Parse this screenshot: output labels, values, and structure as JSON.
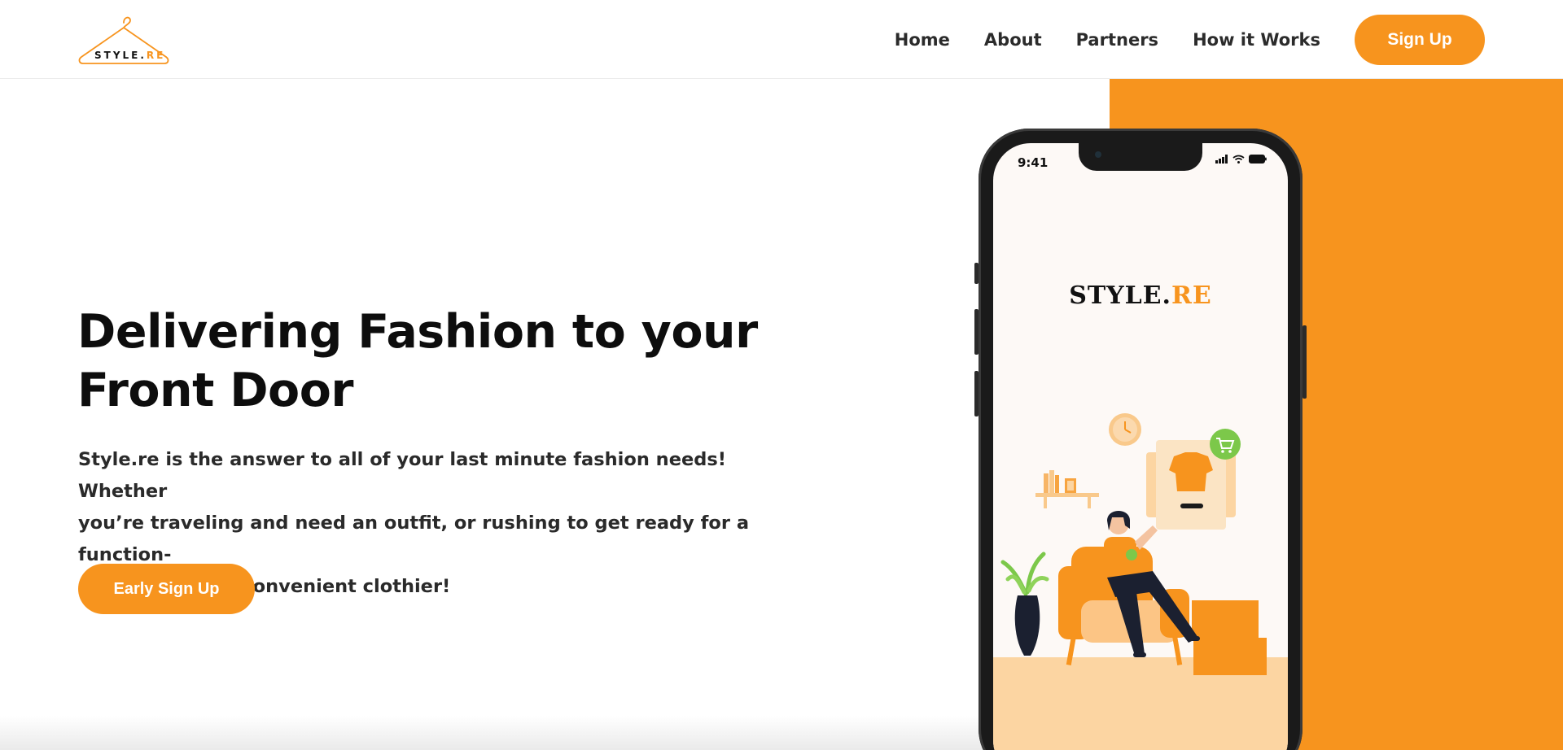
{
  "header": {
    "logo": {
      "text_main": "STYLE.",
      "text_accent": "RE",
      "icon": "hanger-icon"
    },
    "nav": [
      {
        "label": "Home"
      },
      {
        "label": "About"
      },
      {
        "label": "Partners"
      },
      {
        "label": "How it Works"
      }
    ],
    "signup_label": "Sign Up"
  },
  "hero": {
    "title_line1": "Delivering Fashion to your",
    "title_line2": "Front Door",
    "description_line1": "Style.re is the answer to all of your last minute fashion needs! Whether",
    "description_line2": "you’re traveling and need an outfit, or rushing to get ready for a function-",
    "description_line3": "Style.re is your convenient clothier!",
    "cta_label": "Early Sign Up"
  },
  "phone": {
    "status_time": "9:41",
    "app_logo_main": "STYLE.",
    "app_logo_accent": "RE",
    "icons": [
      "signal-icon",
      "wifi-icon",
      "battery-icon",
      "cart-icon",
      "clock-icon",
      "plant-icon"
    ]
  },
  "colors": {
    "accent": "#f7941e",
    "text_dark": "#0d0d0d",
    "floor": "#fcd5a2",
    "cart_badge": "#7cc84a"
  }
}
